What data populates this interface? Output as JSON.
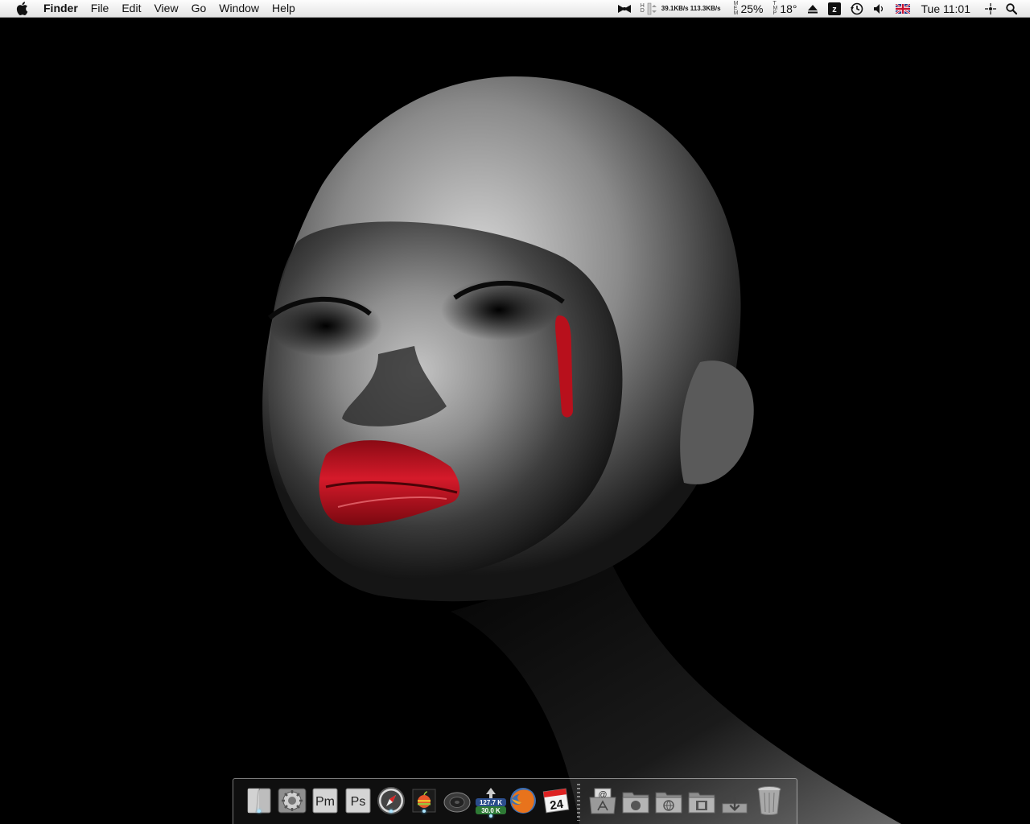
{
  "menubar": {
    "app_name": "Finder",
    "menus": [
      "File",
      "Edit",
      "View",
      "Go",
      "Window",
      "Help"
    ],
    "extras": {
      "net_up": "39.1KB/s",
      "net_down": "113.3KB/s",
      "mem_label": "MEM",
      "mem_value": "25%",
      "temp_label": "TMP",
      "temp_value": "18°",
      "clock": "Tue 11:01"
    }
  },
  "dock": {
    "items": [
      {
        "name": "Finder",
        "icon": "finder-icon",
        "running": true
      },
      {
        "name": "System Preferences",
        "icon": "gear-icon",
        "running": false
      },
      {
        "name": "Pm",
        "icon": "pm-icon",
        "label": "Pm",
        "running": false
      },
      {
        "name": "Ps",
        "icon": "photoshop-icon",
        "label": "Ps",
        "running": false
      },
      {
        "name": "Safari",
        "icon": "compass-icon",
        "running": true
      },
      {
        "name": "Apple",
        "icon": "apple-icon",
        "running": true
      },
      {
        "name": "Speaker",
        "icon": "speaker-icon",
        "running": false
      },
      {
        "name": "Network Meter",
        "icon": "network-meter-icon",
        "meter_up": "127.7 K",
        "meter_down": "30.0 K",
        "running": true
      },
      {
        "name": "Firefox",
        "icon": "firefox-icon",
        "running": false
      },
      {
        "name": "Calendar",
        "icon": "calendar-icon",
        "calendar_day": "24",
        "running": false
      },
      {
        "name": "Mail Folder",
        "icon": "mail-folder-icon",
        "running": false
      },
      {
        "name": "Applications Folder",
        "icon": "apple-folder-icon",
        "running": false
      },
      {
        "name": "Sites Folder",
        "icon": "globe-folder-icon",
        "running": false
      },
      {
        "name": "Movies Folder",
        "icon": "film-folder-icon",
        "running": false
      },
      {
        "name": "Downloads",
        "icon": "download-icon",
        "running": false
      },
      {
        "name": "Trash",
        "icon": "trash-icon",
        "running": false
      }
    ]
  },
  "colors": {
    "menubar_top": "#fdfdfd",
    "menubar_bottom": "#e4e4e4",
    "wallpaper_bg": "#000000",
    "lips": "#c01020",
    "tear": "#b8101c",
    "running_light": "#aee6ff"
  }
}
